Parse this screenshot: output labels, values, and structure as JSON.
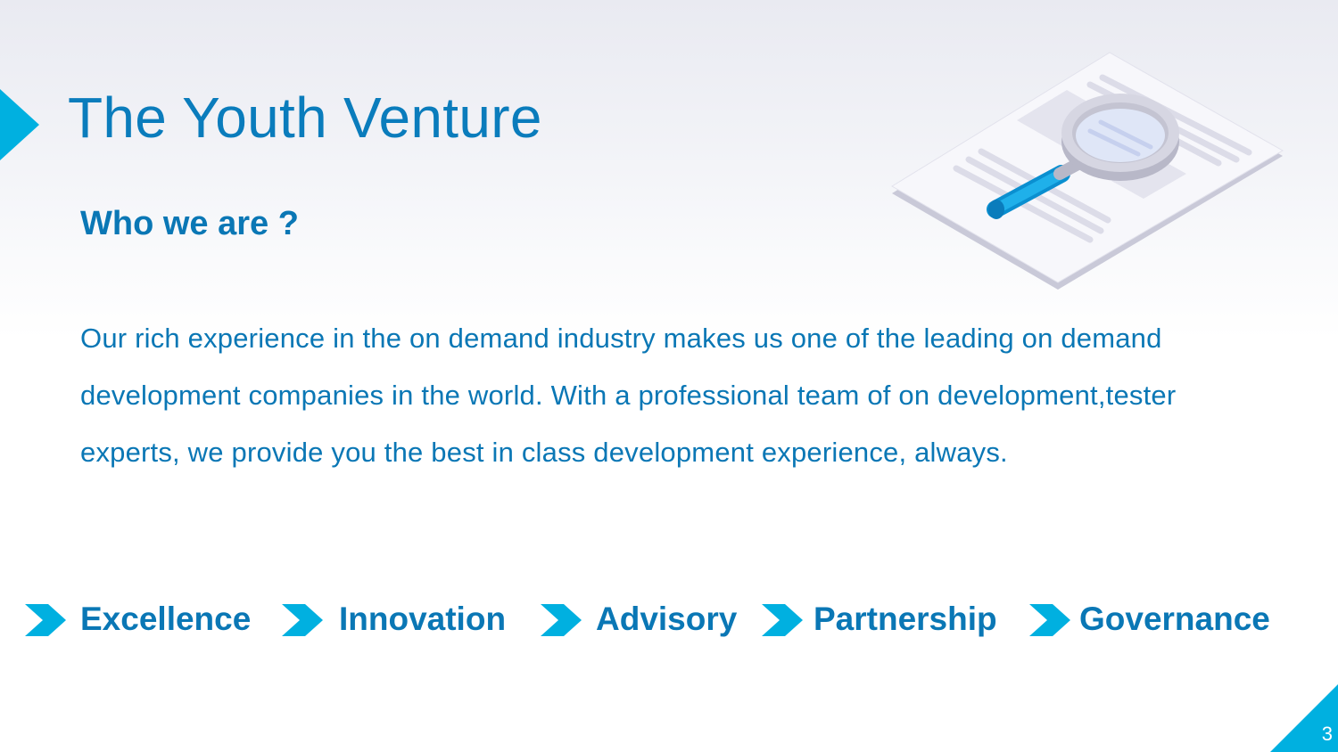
{
  "slide": {
    "title": "The Youth Venture",
    "subtitle": "Who we are ?",
    "body": "Our rich experience in the on demand industry makes us one of the leading on demand development companies in the world. With a professional team of on development,tester experts, we provide you the best in class development experience, always.",
    "page_number": "3"
  },
  "values": [
    {
      "label": "Excellence"
    },
    {
      "label": "Innovation"
    },
    {
      "label": "Advisory"
    },
    {
      "label": "Partnership"
    },
    {
      "label": "Governance"
    }
  ],
  "colors": {
    "primary_text": "#0a77b5",
    "accent": "#00b0e0",
    "background_top": "#e9eaf1",
    "background_bottom": "#ffffff"
  },
  "icons": {
    "illustration": "document-magnifier-illustration",
    "bullet": "chevron-right-icon",
    "title_marker": "triangle-marker-icon",
    "corner": "corner-triangle"
  }
}
